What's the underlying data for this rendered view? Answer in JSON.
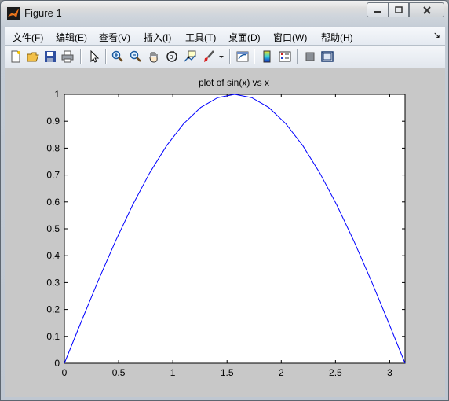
{
  "window": {
    "title": "Figure 1"
  },
  "menu": {
    "items": [
      {
        "label": "文件(F)"
      },
      {
        "label": "编辑(E)"
      },
      {
        "label": "查看(V)"
      },
      {
        "label": "插入(I)"
      },
      {
        "label": "工具(T)"
      },
      {
        "label": "桌面(D)"
      },
      {
        "label": "窗口(W)"
      },
      {
        "label": "帮助(H)"
      }
    ]
  },
  "toolbar": {
    "buttons": [
      {
        "icon": "new-figure-icon"
      },
      {
        "icon": "open-file-icon"
      },
      {
        "icon": "save-icon"
      },
      {
        "icon": "print-icon"
      },
      {
        "icon": "edit-plot-arrow-icon"
      },
      {
        "icon": "zoom-in-icon"
      },
      {
        "icon": "zoom-out-icon"
      },
      {
        "icon": "pan-hand-icon"
      },
      {
        "icon": "rotate-3d-icon"
      },
      {
        "icon": "data-cursor-icon"
      },
      {
        "icon": "brush-icon"
      },
      {
        "icon": "link-plot-icon"
      },
      {
        "icon": "colorbar-icon"
      },
      {
        "icon": "legend-icon"
      },
      {
        "icon": "hide-plot-tools-icon"
      },
      {
        "icon": "show-plot-tools-icon"
      }
    ]
  },
  "chart_data": {
    "type": "line",
    "title": "plot of sin(x) vs x",
    "xlabel": "",
    "ylabel": "",
    "xlim": [
      0,
      3.14159
    ],
    "ylim": [
      0,
      1
    ],
    "xticks": [
      0,
      0.5,
      1,
      1.5,
      2,
      2.5,
      3
    ],
    "xtick_labels": [
      "0",
      "0.5",
      "1",
      "1.5",
      "2",
      "2.5",
      "3"
    ],
    "yticks": [
      0,
      0.1,
      0.2,
      0.3,
      0.4,
      0.5,
      0.6,
      0.7,
      0.8,
      0.9,
      1
    ],
    "ytick_labels": [
      "0",
      "0.1",
      "0.2",
      "0.3",
      "0.4",
      "0.5",
      "0.6",
      "0.7",
      "0.8",
      "0.9",
      "1"
    ],
    "grid": false,
    "colors": {
      "line": "#0000ff",
      "axes_bg": "#ffffff",
      "figure_bg": "#c8c8c8"
    },
    "series": [
      {
        "x": [
          0,
          0.1571,
          0.3142,
          0.4712,
          0.6283,
          0.7854,
          0.9425,
          1.0996,
          1.2566,
          1.4137,
          1.5708,
          1.7279,
          1.885,
          2.042,
          2.1991,
          2.3562,
          2.5133,
          2.6704,
          2.8274,
          2.9845,
          3.1416
        ],
        "y": [
          0,
          0.1564,
          0.309,
          0.454,
          0.5878,
          0.7071,
          0.809,
          0.891,
          0.9511,
          0.9877,
          1.0,
          0.9877,
          0.9511,
          0.891,
          0.809,
          0.7071,
          0.5878,
          0.454,
          0.309,
          0.1564,
          0
        ]
      }
    ]
  }
}
